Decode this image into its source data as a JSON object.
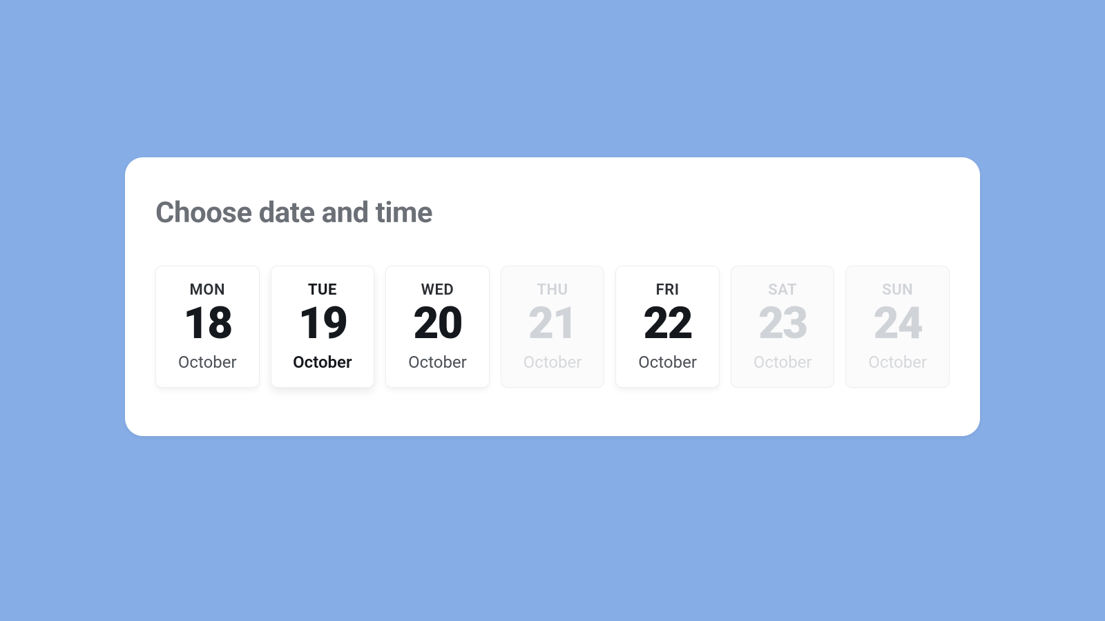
{
  "heading": "Choose date and time",
  "days": [
    {
      "dow": "MON",
      "num": "18",
      "month": "October",
      "state": "available"
    },
    {
      "dow": "TUE",
      "num": "19",
      "month": "October",
      "state": "selected"
    },
    {
      "dow": "WED",
      "num": "20",
      "month": "October",
      "state": "available"
    },
    {
      "dow": "THU",
      "num": "21",
      "month": "October",
      "state": "disabled"
    },
    {
      "dow": "FRI",
      "num": "22",
      "month": "October",
      "state": "available"
    },
    {
      "dow": "SAT",
      "num": "23",
      "month": "October",
      "state": "disabled"
    },
    {
      "dow": "SUN",
      "num": "24",
      "month": "October",
      "state": "disabled"
    }
  ]
}
